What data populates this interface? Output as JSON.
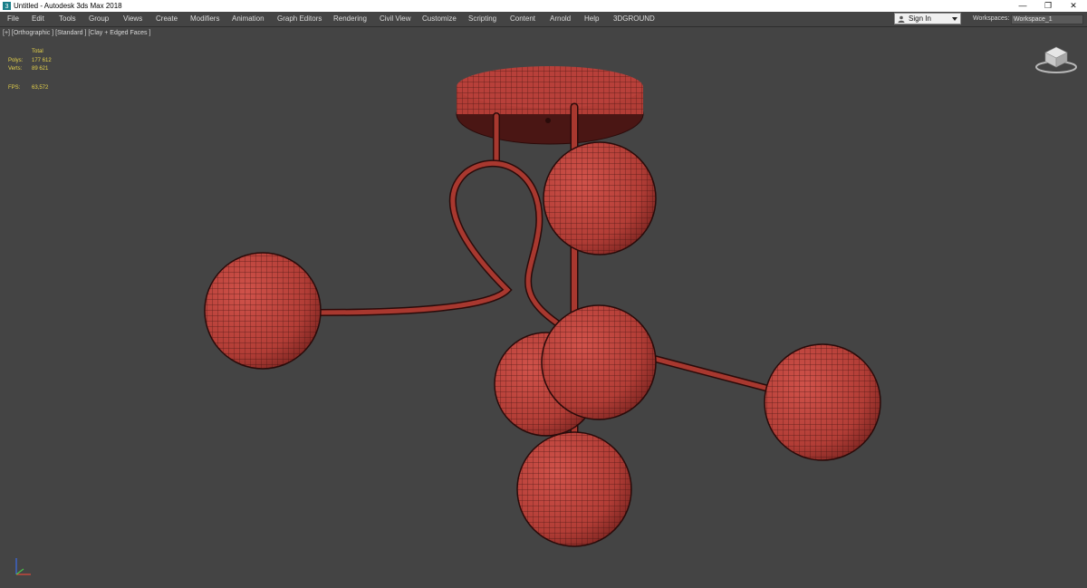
{
  "titlebar": {
    "title": "Untitled - Autodesk 3ds Max 2018",
    "minimize": "—",
    "restore": "❐",
    "close": "✕"
  },
  "menu": [
    "File",
    "Edit",
    "Tools",
    "Group",
    "Views",
    "Create",
    "Modifiers",
    "Animation",
    "Graph Editors",
    "Rendering",
    "Civil View",
    "Customize",
    "Scripting",
    "Content",
    "Arnold",
    "Help",
    "3DGROUND"
  ],
  "signin": {
    "label": "Sign In"
  },
  "workspaces": {
    "label": "Workspaces:",
    "value": "Workspace_1"
  },
  "viewport": {
    "label": "[+] [Orthographic ] [Standard ] [Clay + Edged Faces ]",
    "stats": {
      "header": "Total",
      "polys_label": "Polys:",
      "polys": "177 612",
      "verts_label": "Verts:",
      "verts": "89 621",
      "fps_label": "FPS:",
      "fps": "63,572"
    }
  },
  "colors": {
    "viewport_bg": "#444444",
    "model": "#b8403a",
    "wire": "#3a0f0d",
    "stats_text": "#e6d24a"
  },
  "icons": [
    "app-icon",
    "user-icon",
    "dropdown-caret-icon",
    "viewcube-icon",
    "axis-tripod-icon"
  ]
}
